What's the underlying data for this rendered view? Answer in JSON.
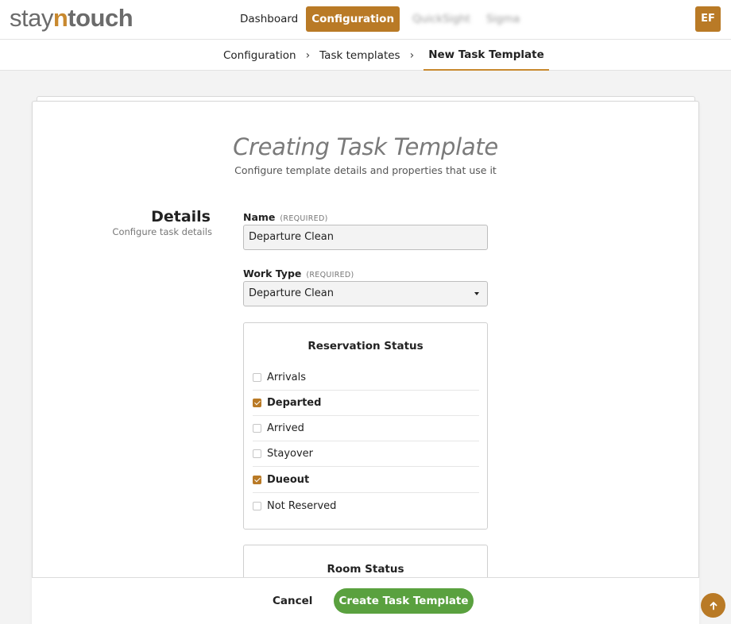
{
  "header": {
    "logo_stay": "stay",
    "logo_n": "n",
    "logo_touch": "touch",
    "nav": [
      {
        "label": "Dashboard"
      },
      {
        "label": "Configuration"
      },
      {
        "label": "QuickSight"
      },
      {
        "label": "Sigma"
      }
    ],
    "avatar_initials": "EF",
    "accent_color": "#b97a26"
  },
  "breadcrumb": {
    "items": [
      "Configuration",
      "Task templates",
      "New Task Template"
    ],
    "separator": "›"
  },
  "page": {
    "title": "Creating Task Template",
    "subtitle": "Configure template details and properties that use it"
  },
  "details": {
    "title": "Details",
    "subtitle": "Configure task details"
  },
  "form": {
    "name_label": "Name",
    "name_req": "(REQUIRED)",
    "name_value": "Departure Clean",
    "worktype_label": "Work Type",
    "worktype_req": "(REQUIRED)",
    "worktype_value": "Departure Clean",
    "reservation_status": {
      "title": "Reservation Status",
      "options": [
        {
          "label": "Arrivals",
          "checked": false
        },
        {
          "label": "Departed",
          "checked": true
        },
        {
          "label": "Arrived",
          "checked": false
        },
        {
          "label": "Stayover",
          "checked": false
        },
        {
          "label": "Dueout",
          "checked": true
        },
        {
          "label": "Not Reserved",
          "checked": false
        }
      ]
    },
    "room_status": {
      "title": "Room Status"
    }
  },
  "footer": {
    "cancel_label": "Cancel",
    "create_label": "Create Task Template",
    "create_color": "#5aa13f"
  },
  "icons": {
    "scroll_top": "arrow-up-icon",
    "dropdown": "caret-down-icon",
    "checkbox": "checkbox-icon"
  }
}
